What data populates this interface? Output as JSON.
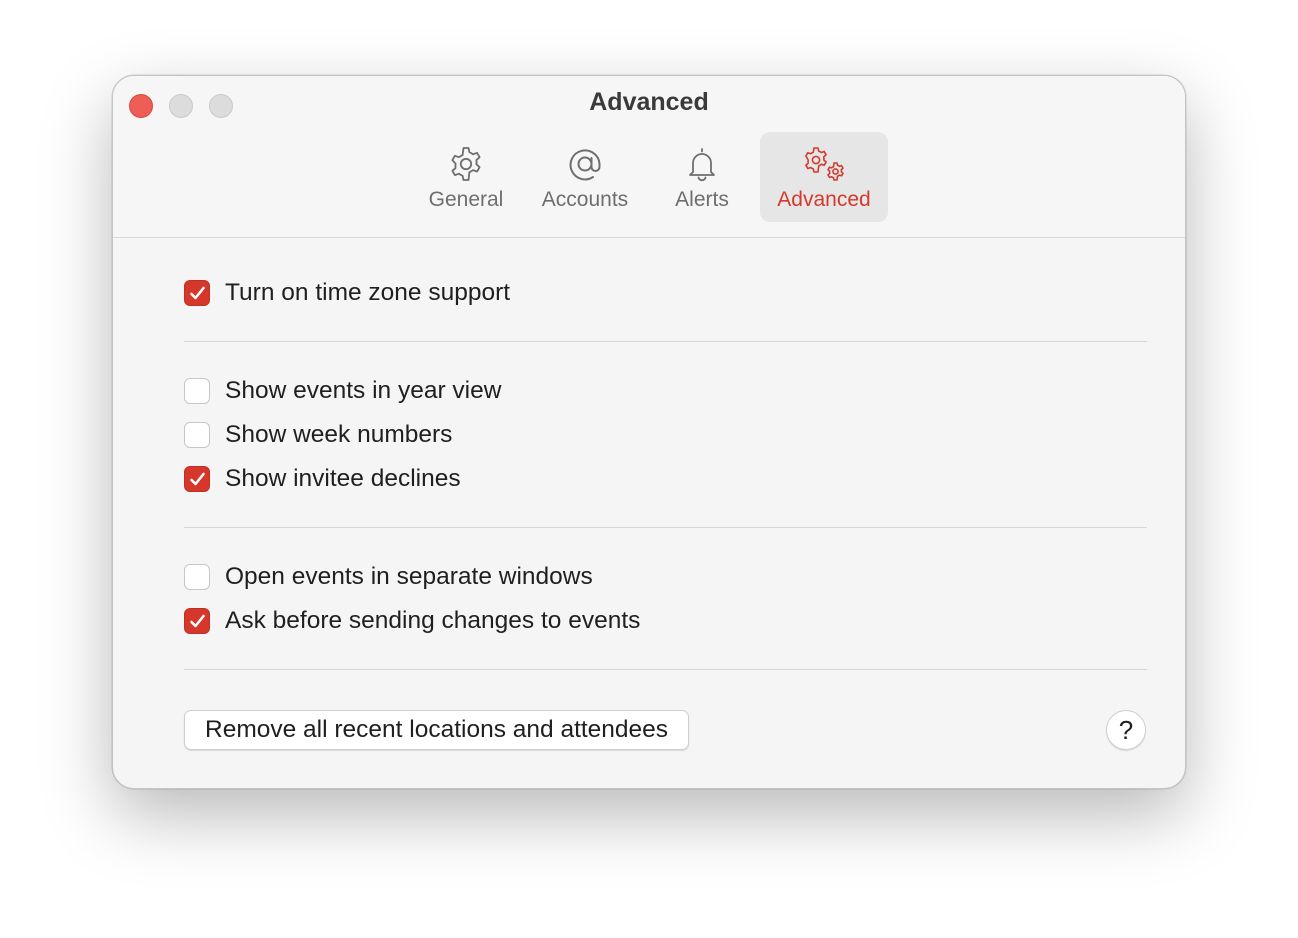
{
  "window": {
    "title": "Advanced"
  },
  "toolbar": {
    "tabs": [
      {
        "label": "General",
        "icon": "gear-icon",
        "active": false
      },
      {
        "label": "Accounts",
        "icon": "at-sign-icon",
        "active": false
      },
      {
        "label": "Alerts",
        "icon": "bell-icon",
        "active": false
      },
      {
        "label": "Advanced",
        "icon": "gears-icon",
        "active": true
      }
    ]
  },
  "settings": {
    "group1": [
      {
        "label": "Turn on time zone support",
        "checked": true
      }
    ],
    "group2": [
      {
        "label": "Show events in year view",
        "checked": false
      },
      {
        "label": "Show week numbers",
        "checked": false
      },
      {
        "label": "Show invitee declines",
        "checked": true
      }
    ],
    "group3": [
      {
        "label": "Open events in separate windows",
        "checked": false
      },
      {
        "label": "Ask before sending changes to events",
        "checked": true
      }
    ]
  },
  "actions": {
    "remove_label": "Remove all recent locations and attendees",
    "help_label": "?"
  },
  "colors": {
    "accent": "#d6372b",
    "close_button": "#ee5d56"
  }
}
